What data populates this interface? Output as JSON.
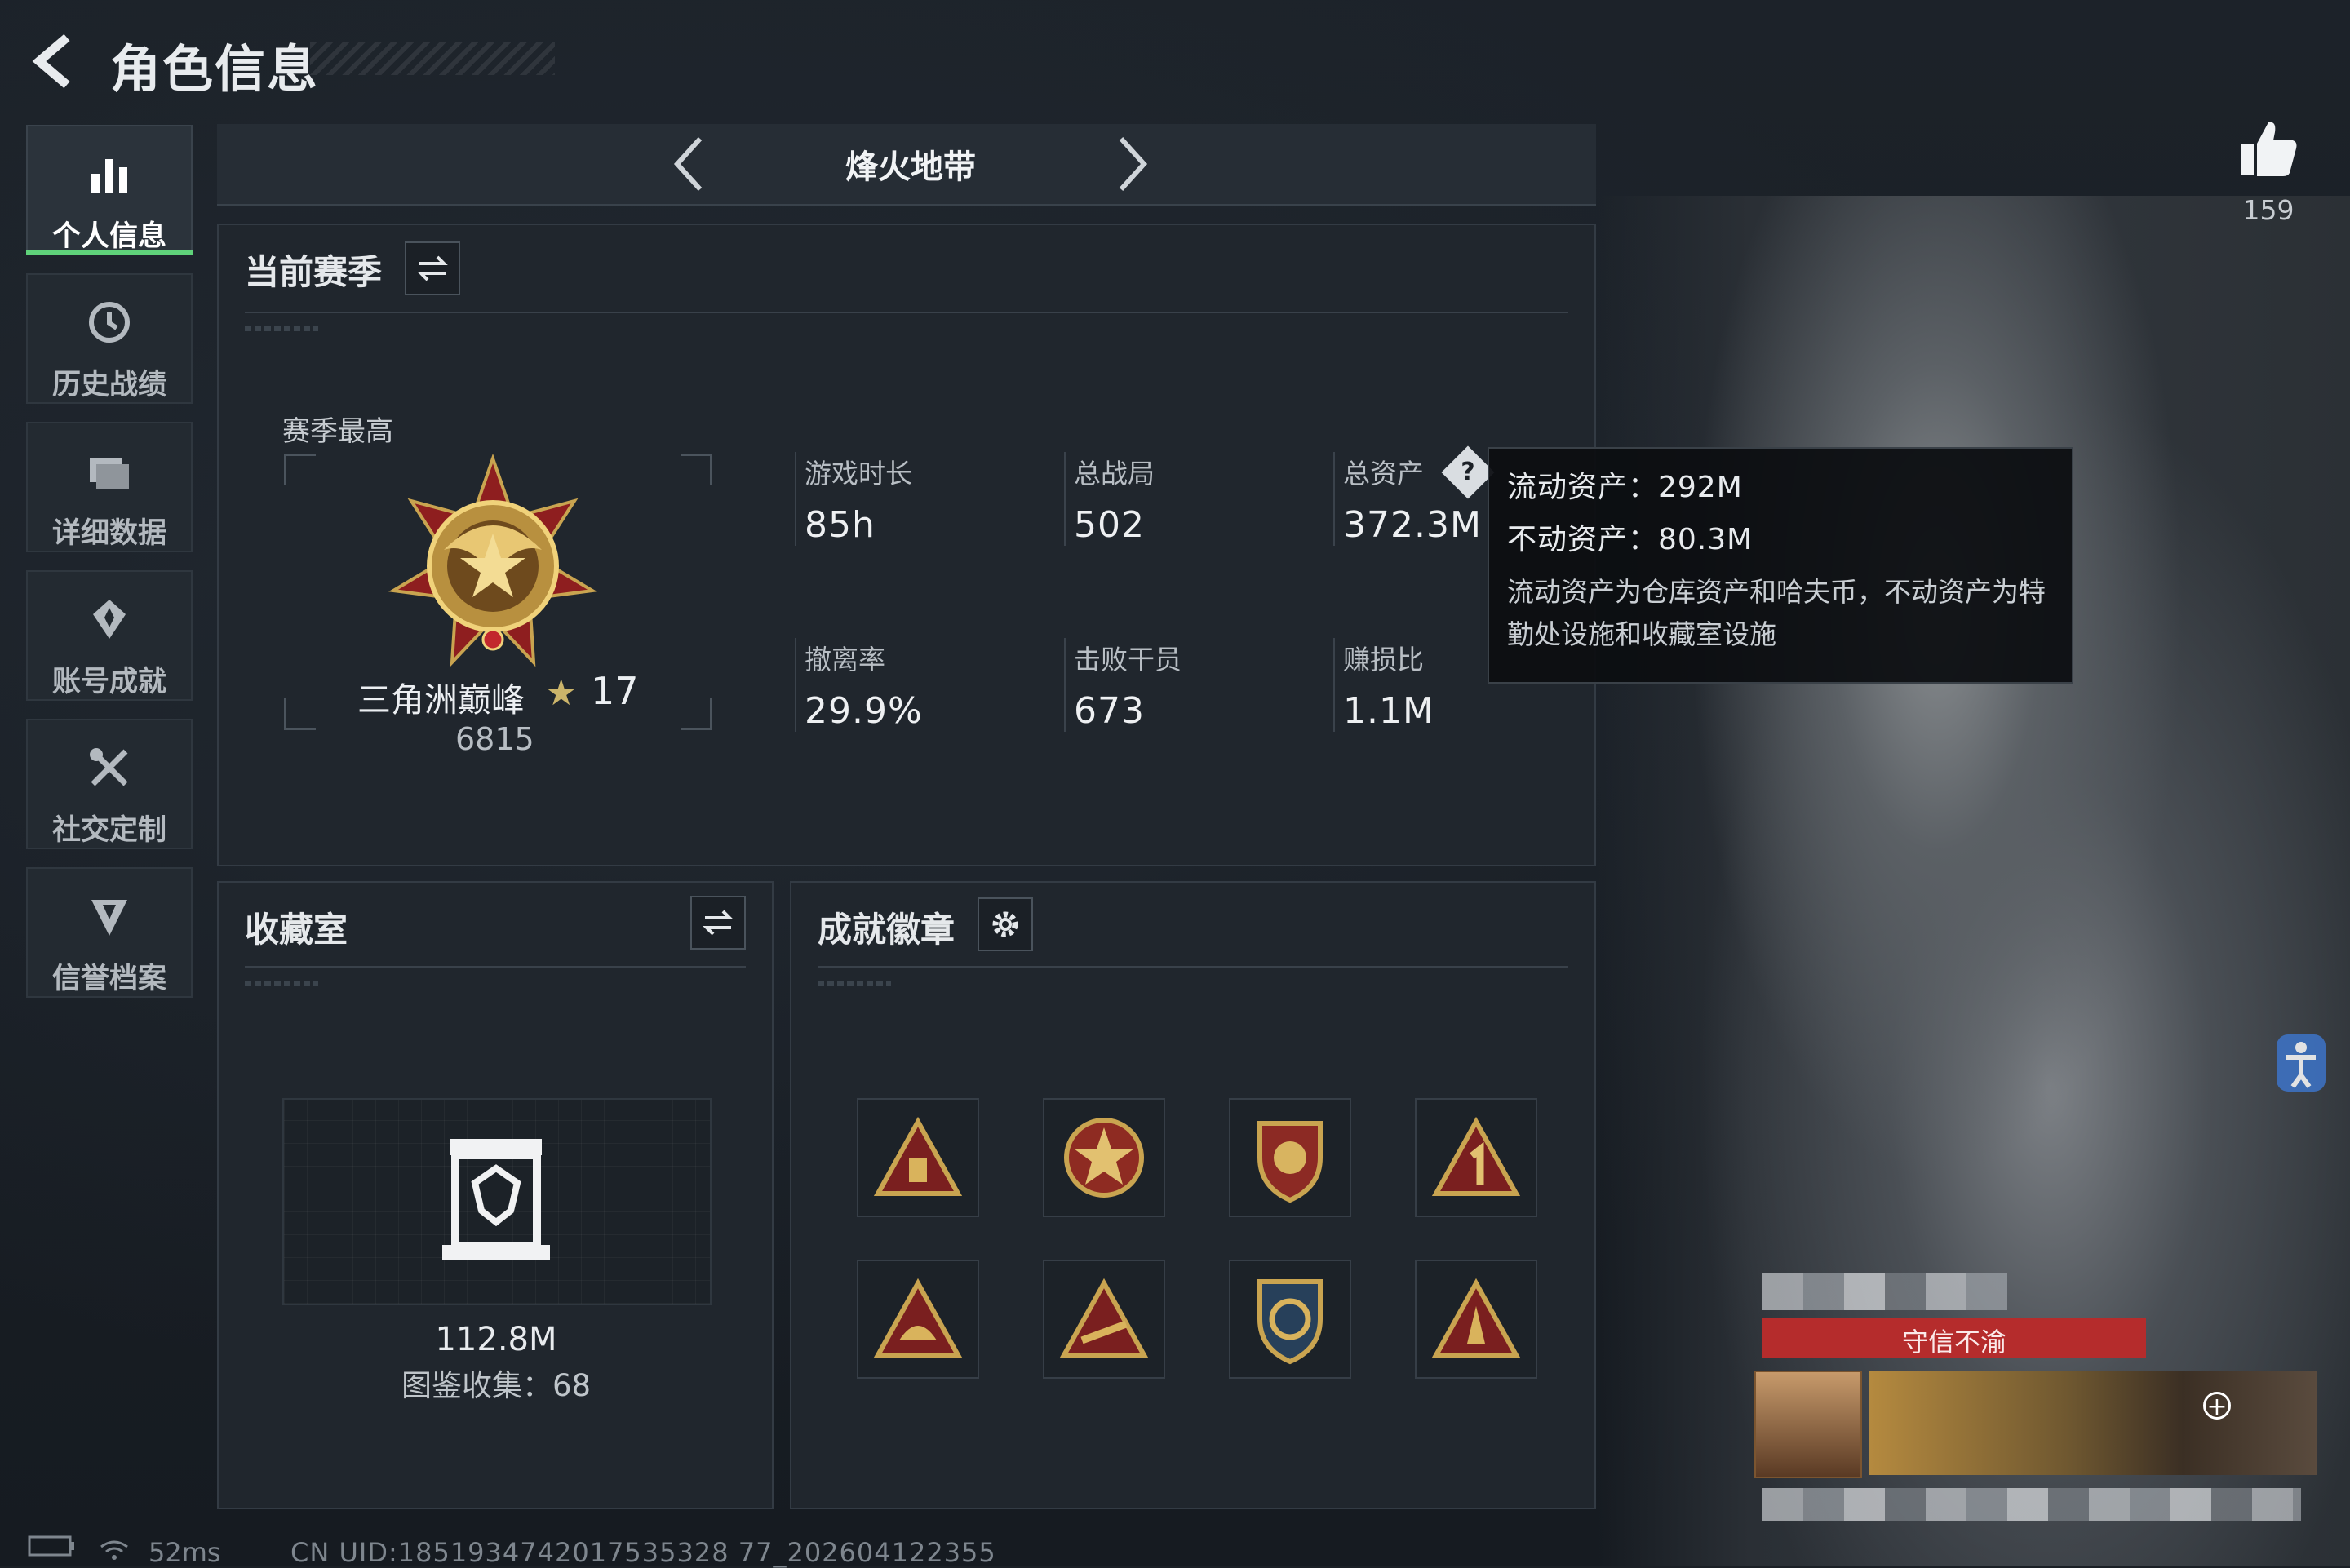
{
  "header": {
    "title": "角色信息"
  },
  "sidebar": {
    "items": [
      {
        "label": "个人信息",
        "icon": "bar-chart-icon",
        "active": true
      },
      {
        "label": "历史战绩",
        "icon": "history-clock-icon"
      },
      {
        "label": "详细数据",
        "icon": "folder-icon"
      },
      {
        "label": "账号成就",
        "icon": "achievement-icon"
      },
      {
        "label": "社交定制",
        "icon": "tools-icon"
      },
      {
        "label": "信誉档案",
        "icon": "shield-credit-icon"
      }
    ]
  },
  "mode": {
    "title": "烽火地带"
  },
  "season": {
    "title": "当前赛季",
    "best_label": "赛季最高",
    "rank_name": "三角洲巅峰",
    "rank_star": "★",
    "rank_level": "17",
    "rank_score": "6815",
    "stats": [
      {
        "label": "游戏时长",
        "value": "85h"
      },
      {
        "label": "总战局",
        "value": "502"
      },
      {
        "label": "总资产",
        "value": "372.3M"
      },
      {
        "label": "撤离率",
        "value": "29.9%"
      },
      {
        "label": "击败干员",
        "value": "673"
      },
      {
        "label": "赚损比",
        "value": "1.1M"
      }
    ],
    "help_glyph": "?"
  },
  "tooltip": {
    "liquid": "流动资产：292M",
    "fixed": "不动资产：80.3M",
    "description": "流动资产为仓库资产和哈夫币，不动资产为特勤处设施和收藏室设施"
  },
  "collection": {
    "title": "收藏室",
    "value": "112.8M",
    "catalog": "图鉴收集：68"
  },
  "badges": {
    "title": "成就徽章"
  },
  "likes": {
    "count": "159"
  },
  "card": {
    "banner": "守信不渝"
  },
  "status": {
    "ping": "52ms",
    "uid": "CN UID:1851934742017535328 77_202604122355"
  },
  "colors": {
    "accent_green": "#5fd27a",
    "banner_red": "#b52c2c",
    "badge_gold": "#c9a450"
  }
}
